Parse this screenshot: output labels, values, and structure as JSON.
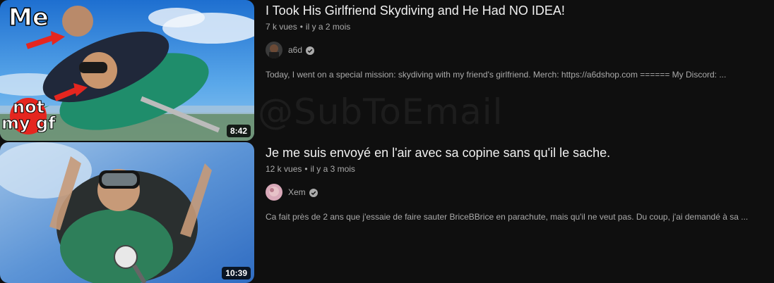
{
  "watermark": "@SubToEmail",
  "results": [
    {
      "title": "I Took His Girlfriend Skydiving and He Had NO IDEA!",
      "views": "7 k vues",
      "age": "il y a 2 mois",
      "channel": "a6d",
      "description": "Today, I went on a special mission: skydiving with my friend's girlfriend. Merch: https://a6dshop.com ====== My Discord: ...",
      "duration": "8:42",
      "thumb_text_top": "Me",
      "thumb_text_bottom_1": "not",
      "thumb_text_bottom_2": "my gf"
    },
    {
      "title": "Je me suis envoyé en l'air avec sa copine sans qu'il le sache.",
      "views": "12 k vues",
      "age": "il y a 3 mois",
      "channel": "Xem",
      "description": "Ca fait près de 2 ans que j'essaie de faire sauter BriceBBrice en parachute, mais qu'il ne veut pas. Du coup, j'ai demandé à sa ...",
      "duration": "10:39"
    }
  ],
  "separator": "•",
  "icons": {
    "verified": "verified-check-icon"
  }
}
